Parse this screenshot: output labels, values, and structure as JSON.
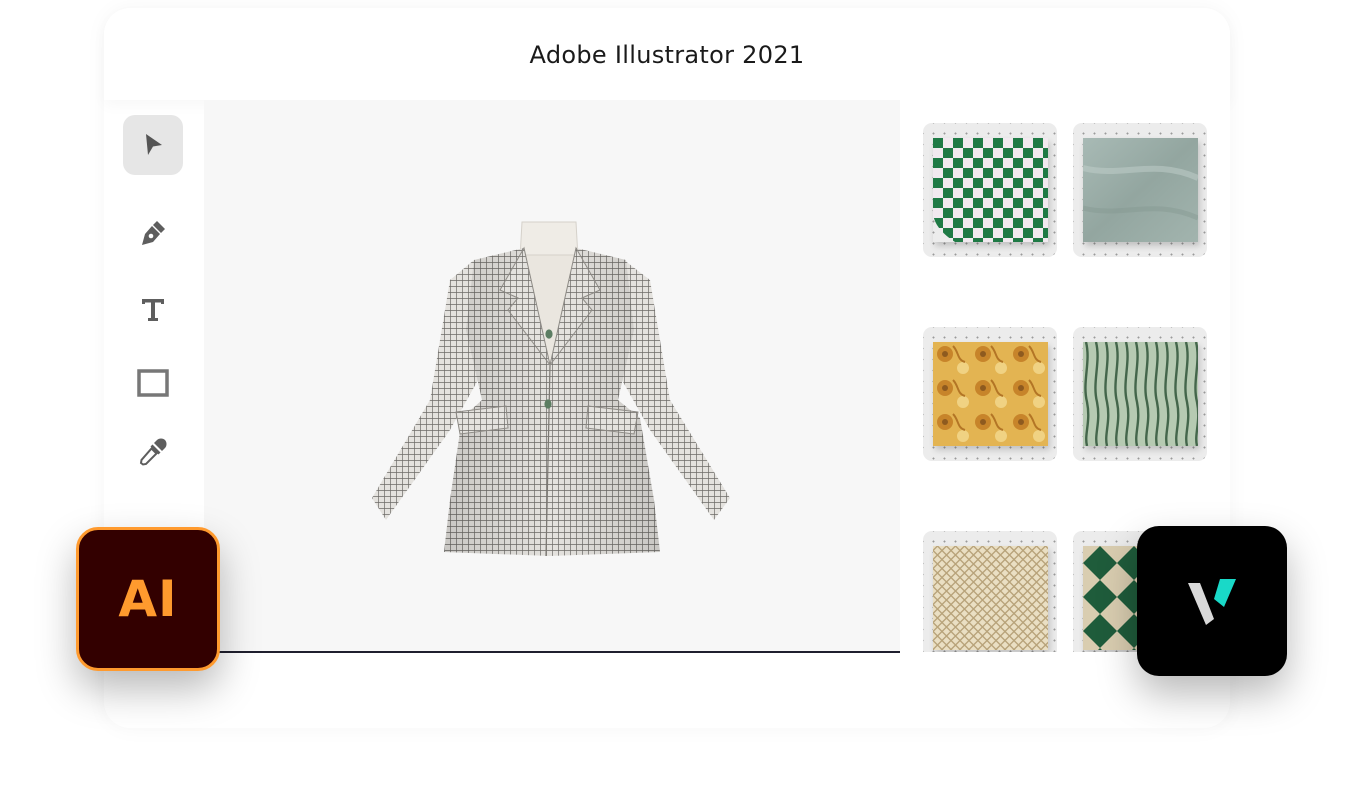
{
  "window": {
    "title": "Adobe Illustrator 2021"
  },
  "toolbar": {
    "tools": [
      {
        "name": "selection-tool",
        "icon": "arrow-cursor-icon",
        "active": true
      },
      {
        "name": "pen-tool",
        "icon": "pen-icon",
        "active": false
      },
      {
        "name": "type-tool",
        "icon": "text-icon",
        "active": false
      },
      {
        "name": "rectangle-tool",
        "icon": "rectangle-icon",
        "active": false
      },
      {
        "name": "eyedropper-tool",
        "icon": "eyedropper-icon",
        "active": false
      }
    ]
  },
  "canvas": {
    "artwork": "plaid-blazer-3d-garment"
  },
  "swatches": [
    {
      "name": "green-white-checkerboard",
      "colors": [
        "#1f7a45",
        "#f1e9ef"
      ]
    },
    {
      "name": "sage-grey-solid",
      "colors": [
        "#9fb1ac"
      ]
    },
    {
      "name": "mustard-floral",
      "colors": [
        "#c98b26",
        "#eac66a"
      ]
    },
    {
      "name": "green-wavy-stripe",
      "colors": [
        "#6f8e72",
        "#b4c8b0"
      ]
    },
    {
      "name": "beige-lattice-knit",
      "colors": [
        "#d8c9a6",
        "#efe4c9"
      ]
    },
    {
      "name": "green-beige-harlequin",
      "colors": [
        "#1f5c3b",
        "#d9cdb0"
      ]
    }
  ],
  "badges": {
    "illustrator": {
      "label": "AI",
      "bg": "#330000",
      "accent": "#ff9a2e"
    },
    "style3d": {
      "icon": "v-logo-icon",
      "bg": "#000000",
      "accent": "#19d9c8"
    }
  }
}
